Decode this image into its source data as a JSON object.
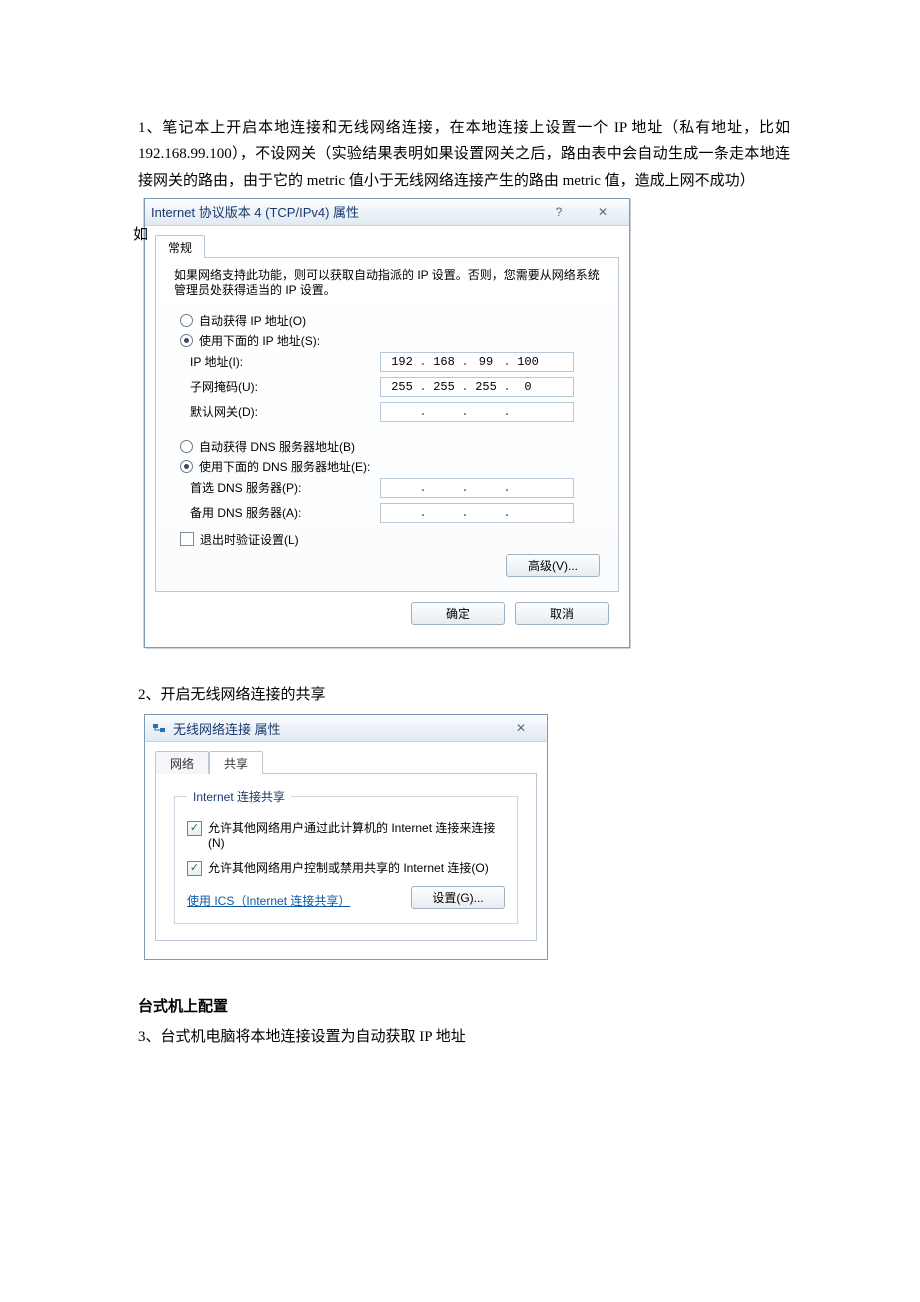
{
  "para1_text": "1、笔记本上开启本地连接和无线网络连接，在本地连接上设置一个 IP 地址（私有地址，比如 192.168.99.100），不设网关（实验结果表明如果设置网关之后，路由表中会自动生成一条走本地连接网关的路由，由于它的 metric 值小于无线网络连接产生的路由 metric 值，造成上网不成功）",
  "dlg1": {
    "sidechar": "如",
    "title": "Internet 协议版本 4 (TCP/IPv4) 属性",
    "help_symbol": "?",
    "close_symbol": "✕",
    "tab": "常规",
    "desc": "如果网络支持此功能，则可以获取自动指派的 IP 设置。否则，您需要从网络系统管理员处获得适当的 IP 设置。",
    "auto_ip": "自动获得 IP 地址(O)",
    "use_ip": "使用下面的 IP 地址(S):",
    "ip_label": "IP 地址(I):",
    "ip_oct": [
      "192",
      "168",
      "99",
      "100"
    ],
    "mask_label": "子网掩码(U):",
    "mask_oct": [
      "255",
      "255",
      "255",
      "0"
    ],
    "gw_label": "默认网关(D):",
    "gw_oct": [
      "",
      "",
      "",
      ""
    ],
    "auto_dns": "自动获得 DNS 服务器地址(B)",
    "use_dns": "使用下面的 DNS 服务器地址(E):",
    "dns1_label": "首选 DNS 服务器(P):",
    "dns2_label": "备用 DNS 服务器(A):",
    "validate": "退出时验证设置(L)",
    "advanced": "高级(V)...",
    "ok": "确定",
    "cancel": "取消"
  },
  "para2_text": "2、开启无线网络连接的共享",
  "dlg2": {
    "title": "无线网络连接 属性",
    "close_symbol": "✕",
    "tab_network": "网络",
    "tab_share": "共享",
    "legend": "Internet 连接共享",
    "chk1": "允许其他网络用户通过此计算机的 Internet 连接来连接(N)",
    "chk2": "允许其他网络用户控制或禁用共享的 Internet 连接(O)",
    "link": "使用 ICS（Internet 连接共享）",
    "settings_btn": "设置(G)..."
  },
  "heading3": "台式机上配置",
  "para3_text": "3、台式机电脑将本地连接设置为自动获取 IP 地址"
}
